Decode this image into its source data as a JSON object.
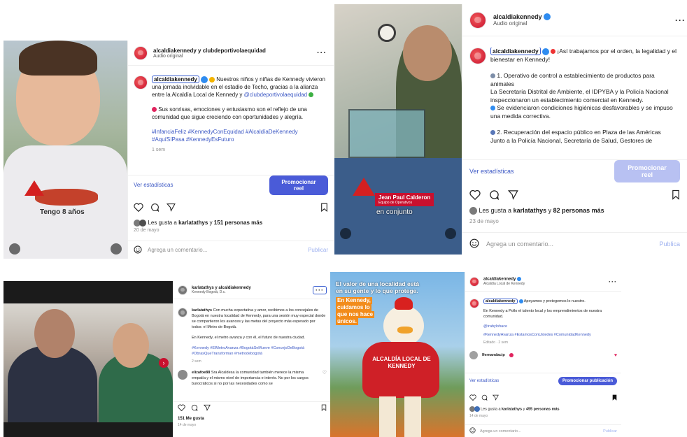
{
  "post1": {
    "header_user": "alcaldiakennedy y clubdeportivolaequidad",
    "header_sub": "Audio original",
    "caption_user": "alcaldiakennedy",
    "caption_text": "Nuestros niños y niñas de Kennedy vivieron una jornada inolvidable en el estadio de Techo, gracias a la alianza entre la Alcaldía Local de Kennedy y",
    "caption_mention": "@clubdeportivolaequidad",
    "caption_p2": "Sus sonrisas, emociones y entusiasmo son el reflejo de una comunidad que sigue creciendo con oportunidades y alegría.",
    "hashtags": "#InfanciaFeliz #KennedyConEquidad #AlcaldíaDeKennedy #AquíSíPasa #KennedyEsFuturo",
    "time": "1 sem",
    "stats_link": "Ver estadísticas",
    "promo_button": "Promocionar reel",
    "likes_prefix": "Les gusta a",
    "likes_user": "karlatathys",
    "likes_mid": "y",
    "likes_count": "151 personas más",
    "date": "20 de mayo",
    "comment_placeholder": "Agrega un comentario...",
    "publish": "Publicar",
    "shirt_text": "Tengo 8 años"
  },
  "post2": {
    "header_user": "alcaldiakennedy",
    "header_sub": "Audio original",
    "caption_user": "alcaldiakennedy",
    "caption_lead": "¡Así trabajamos por el orden, la legalidad y el bienestar en Kennedy!",
    "item1_title": "1. Operativo de control a establecimiento de productos para animales",
    "item1_body": "La Secretaría Distrital de Ambiente, el IDPYBA y la Policía Nacional inspeccionaron un establecimiento comercial en Kennedy.",
    "item1_result": "Se evidenciaron condiciones higiénicas desfavorables y se impuso una medida correctiva.",
    "item2_title": "2. Recuperación del espacio público en Plaza de las Américas",
    "item2_body": "Junto a la Policía Nacional, Secretaría de Salud, Gestores de",
    "stats_link": "Ver estadísticas",
    "promo_button": "Promocionar reel",
    "likes_prefix": "Les gusta a",
    "likes_user": "karlatathys",
    "likes_mid": "y",
    "likes_count": "82 personas más",
    "date": "23 de mayo",
    "comment_placeholder": "Agrega un comentario...",
    "publish": "Publica",
    "lower_third_name": "Jean Paul Calderon",
    "lower_third_role": "Equipo de Operativos",
    "subtitle": "en conjunto"
  },
  "post3": {
    "header_user": "karlatathys y alcaldiakennedy",
    "header_sub": "Kennedy Bogotá, D.c.",
    "caption_user": "karlatathys",
    "caption_text": "Con mucha expectativa y amor, recibimos a los concejales de Bogotá en nuestra localidad de Kennedy, para una sesión muy especial donde se compartieron los avances y las metas del proyecto más esperado por todos: el Metro de Bogotá.",
    "caption_p2": "En Kennedy, el metro avanza y con él, el futuro de nuestra ciudad.",
    "hashtags": "#Kennedy #ElMetroAvanza #BogotáSeMueve #ConcejoDeBogotá #ObrasQueTransforman #metrodebogotá",
    "time": "2 sem",
    "commenter": "elizafoe88",
    "comment_text": "Sra Alcaldesa la comunidad también merece la misma empatía y el mismo nivel de importancia e interés. No por los cargos burocráticos si no por las necesidades como se",
    "likes_text": "151 Me gusta",
    "date": "14 de mayo"
  },
  "post4": {
    "media_headline": "El valor de una localidad está en su gente y lo que protege.",
    "media_tag_l1": "En Kennedy,",
    "media_tag_l2": "cuidamos lo",
    "media_tag_l3": "que nos hace",
    "media_tag_l4": "únicos.",
    "mascot_shirt": "ALCALDÍA LOCAL DE KENNEDY",
    "header_user": "alcaldiakennedy",
    "header_sub": "Alcaldía Local de Kennedy",
    "caption_user": "alcaldiakennedy",
    "caption_text": "Apoyamos y protegemos lo nuestro.",
    "caption_p2": "En Kennedy a Pollo el talento local y los emprendimientos de nuestra comunidad.",
    "mention": "@trabylohace",
    "hashtags": "#KennedyAvanza #EstamosConUstedes #ComunidadKennedy",
    "time": "Editado · 2 sem",
    "commenter": "lfernandacip",
    "stats_link": "Ver estadísticas",
    "promo_button": "Promocionar publicación",
    "likes_prefix": "Les gusta a",
    "likes_user": "karlatathys",
    "likes_mid": "y",
    "likes_count": "455 personas más",
    "date": "14 de mayo",
    "comment_placeholder": "Agrega un comentario...",
    "publish": "Publicar"
  },
  "colors": {
    "accent": "#4a5bd8",
    "link": "#3b57c4",
    "brand_red": "#c8102e"
  }
}
